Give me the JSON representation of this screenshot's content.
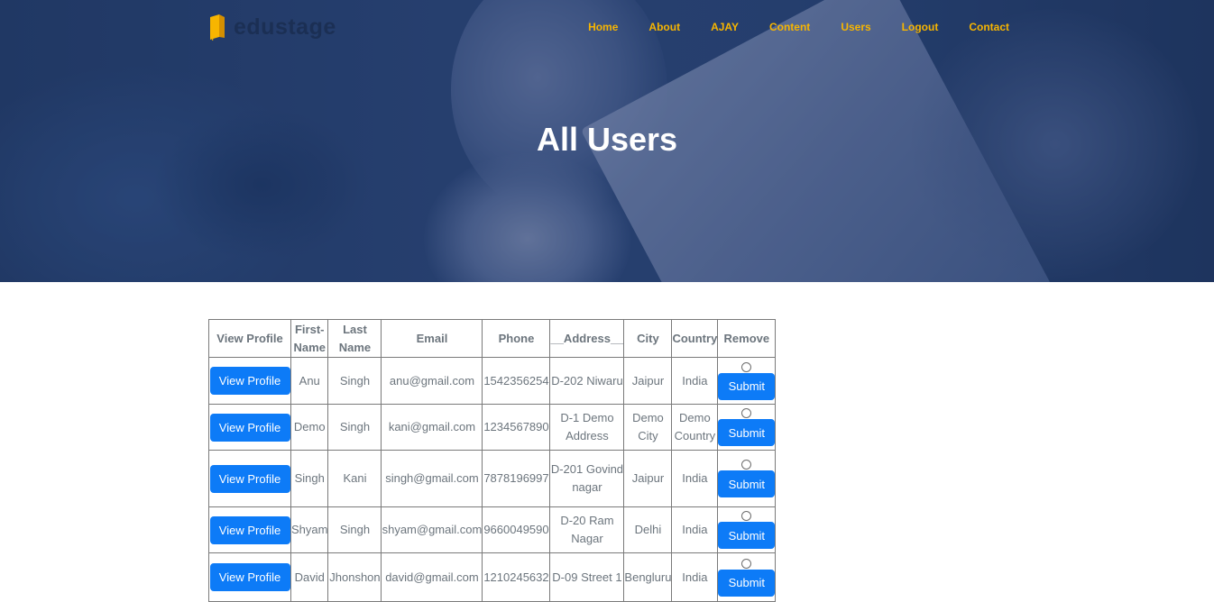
{
  "brand": {
    "name": "edustage",
    "icon": "book-icon"
  },
  "nav": [
    "Home",
    "About",
    "AJAY",
    "Content",
    "Users",
    "Logout",
    "Contact"
  ],
  "page": {
    "title": "All Users"
  },
  "table": {
    "headers": {
      "view_profile": "View Profile",
      "first_name": "First-Name",
      "last_name": "Last Name",
      "email": "Email",
      "phone": "Phone",
      "address": "__Address__",
      "city": "City",
      "country": "Country",
      "remove": "Remove"
    },
    "view_label": "View Profile",
    "submit_label": "Submit",
    "rows": [
      {
        "first": "Anu",
        "last": "Singh",
        "email": "anu@gmail.com",
        "phone": "1542356254",
        "address": "D-202 Niwaru",
        "city": "Jaipur",
        "country": "India"
      },
      {
        "first": "Demo",
        "last": "Singh",
        "email": "kani@gmail.com",
        "phone": "1234567890",
        "address": "D-1 Demo Address",
        "city": "Demo City",
        "country": "Demo Country"
      },
      {
        "first": "Singh",
        "last": "Kani",
        "email": "singh@gmail.com",
        "phone": "7878196997",
        "address": "D-201 Govind nagar",
        "city": "Jaipur",
        "country": "India"
      },
      {
        "first": "Shyam",
        "last": "Singh",
        "email": "shyam@gmail.com",
        "phone": "9660049590",
        "address": "D-20 Ram Nagar",
        "city": "Delhi",
        "country": "India"
      },
      {
        "first": "David",
        "last": "Jhonshon",
        "email": "david@gmail.com",
        "phone": "1210245632",
        "address": "D-09 Street 1",
        "city": "Bengluru",
        "country": "India"
      }
    ]
  },
  "colors": {
    "accent": "#f7b500",
    "button": "#0d7bf7",
    "hero": "#2a4474"
  }
}
